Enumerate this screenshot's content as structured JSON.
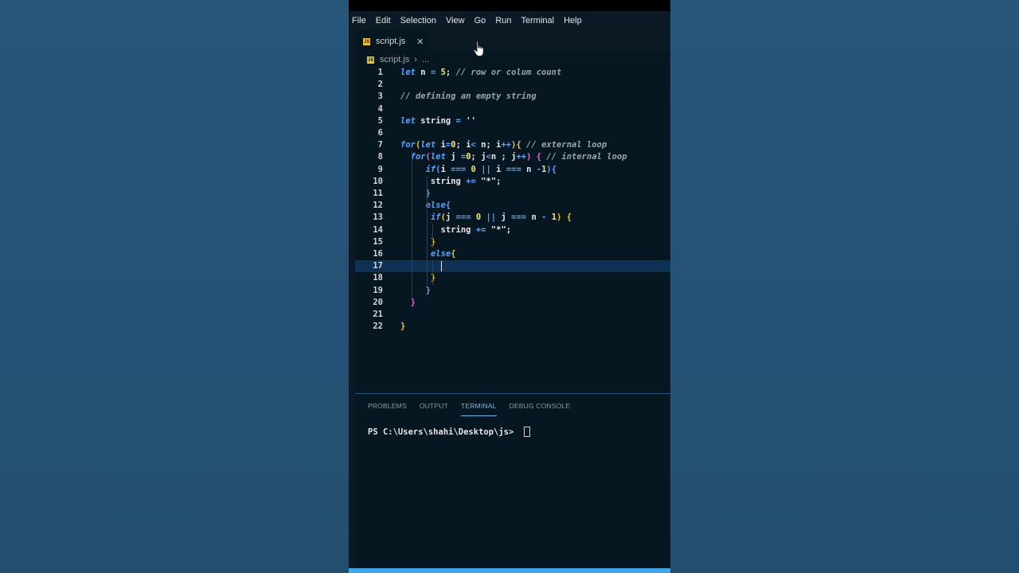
{
  "menubar": {
    "items": [
      "File",
      "Edit",
      "Selection",
      "View",
      "Go",
      "Run",
      "Terminal",
      "Help"
    ]
  },
  "tab": {
    "label": "script.js",
    "close": "✕",
    "icon": "js-file-icon",
    "icon_text": "JS"
  },
  "breadcrumb": {
    "file": "script.js",
    "separator": "›",
    "more": "..."
  },
  "editor": {
    "current_line": 17,
    "line_numbers": [
      "1",
      "2",
      "3",
      "4",
      "5",
      "6",
      "7",
      "8",
      "9",
      "10",
      "11",
      "12",
      "13",
      "14",
      "15",
      "16",
      "17",
      "18",
      "19",
      "20",
      "21",
      "22"
    ],
    "lines": [
      "let n = 5; // row or colum count",
      "",
      "// defining an empty string",
      "",
      "let string = ''",
      "",
      "for(let i=0; i< n; i++){ // external loop",
      "  for(let j =0; j<n ; j++) { // internal loop",
      "     if(i === 0 || i === n -1){",
      "      string += \"*\";",
      "     }",
      "     else{",
      "      if(j === 0 || j === n - 1) {",
      "        string += \"*\";",
      "      }",
      "      else{",
      "        ",
      "      }",
      "     }",
      "  }",
      "",
      "}"
    ]
  },
  "panel": {
    "tabs": [
      "PROBLEMS",
      "OUTPUT",
      "TERMINAL",
      "DEBUG CONSOLE"
    ],
    "active_tab": "TERMINAL",
    "prompt": "PS C:\\Users\\shahi\\Desktop\\js> "
  },
  "colors": {
    "keyword": "#58a6ff",
    "comment": "#9aa4ad",
    "number": "#f5e66e",
    "bracket": "#f2c73c",
    "status_bar": "#3ea7e8",
    "background": "#061722"
  }
}
